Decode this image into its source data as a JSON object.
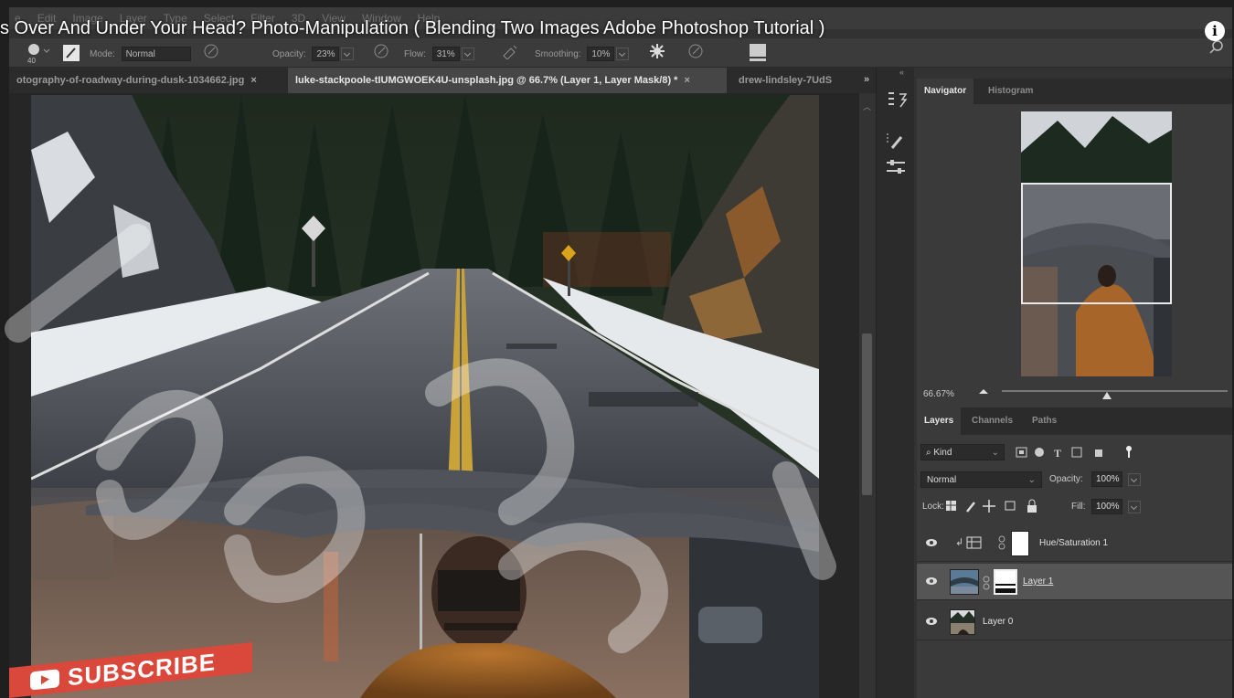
{
  "video_title": "s Over And Under Your Head? Photo-Manipulation ( Blending Two Images Adobe Photoshop Tutorial )",
  "menu": [
    "e",
    "Edit",
    "Image",
    "Layer",
    "Type",
    "Select",
    "Filter",
    "3D",
    "View",
    "Window",
    "Help"
  ],
  "options": {
    "brush_size": "40",
    "mode_label": "Mode:",
    "mode_value": "Normal",
    "opacity_label": "Opacity:",
    "opacity_value": "23%",
    "flow_label": "Flow:",
    "flow_value": "31%",
    "smoothing_label": "Smoothing:",
    "smoothing_value": "10%"
  },
  "tabs": [
    {
      "label": "otography-of-roadway-during-dusk-1034662.jpg",
      "close": "×"
    },
    {
      "label": "luke-stackpoole-tIUMGWOEK4U-unsplash.jpg @ 66.7% (Layer 1, Layer Mask/8) *",
      "close": "×"
    },
    {
      "label": "drew-lindsley-7UdS"
    }
  ],
  "tabs_more": "»",
  "collapse": "«",
  "navigator": {
    "tabs": [
      "Navigator",
      "Histogram"
    ],
    "zoom": "66.67%"
  },
  "layers_panel": {
    "tabs": [
      "Layers",
      "Channels",
      "Paths"
    ],
    "kind_label": "Kind",
    "blend_mode": "Normal",
    "opacity_label": "Opacity:",
    "opacity_value": "100%",
    "lock_label": "Lock:",
    "fill_label": "Fill:",
    "fill_value": "100%",
    "layers": [
      {
        "name": "Hue/Saturation 1"
      },
      {
        "name": "Layer 1"
      },
      {
        "name": "Layer 0"
      }
    ]
  },
  "subscribe": "SUBSCRIBE",
  "colors": {
    "subscribe_bg": "#d9483a",
    "active_tab": "#464646",
    "panel_bg": "#3a3a3a"
  }
}
